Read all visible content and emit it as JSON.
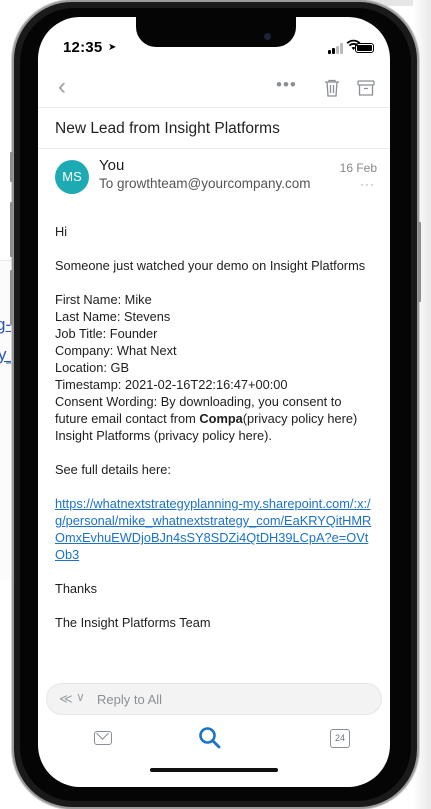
{
  "background": {
    "link_line1": "g-",
    "link_line2": "y_c"
  },
  "status_bar": {
    "time": "12:35",
    "location_glyph": "➤",
    "wifi_glyph": "📶"
  },
  "toolbar": {
    "back_glyph": "‹",
    "more_glyph": "•••",
    "icons": [
      "back-icon",
      "more-icon",
      "trash-icon",
      "archive-icon"
    ]
  },
  "email": {
    "subject": "New Lead from Insight Platforms",
    "avatar_initials": "MS",
    "sender": "You",
    "to_line": "To growthteam@yourcompany.com",
    "date": "16 Feb",
    "date_more": "···",
    "greeting": "Hi",
    "intro": "Someone just watched your demo on Insight Platforms",
    "fields": [
      "First Name: Mike",
      "Last Name: Stevens",
      "Job Title: Founder",
      "Company: What Next",
      "Location: GB",
      "Timestamp: 2021-02-16T22:16:47+00:00"
    ],
    "consent_prefix": "Consent Wording: By downloading, you consent to future email contact from ",
    "consent_bold": "Compa",
    "consent_suffix": "(privacy policy here) Insight Platforms (privacy policy here).",
    "details_label": "See full details here:",
    "details_link": "https://whatnextstrategyplanning-my.sharepoint.com/:x:/g/personal/mike_whatnextstrategy_com/EaKRYQitHMROmxEvhuEWDjoBJn4sSY8SDZi4QtDH39LCpA?e=OVtOb3",
    "thanks": "Thanks",
    "signature": "The Insight Platforms Team"
  },
  "reply": {
    "icon_glyph": "≪",
    "chevron_glyph": "∨",
    "placeholder": "Reply to All"
  },
  "tabbar": {
    "calendar_day": "24",
    "active_tab": "search",
    "accent_color": "#1b72c9"
  }
}
